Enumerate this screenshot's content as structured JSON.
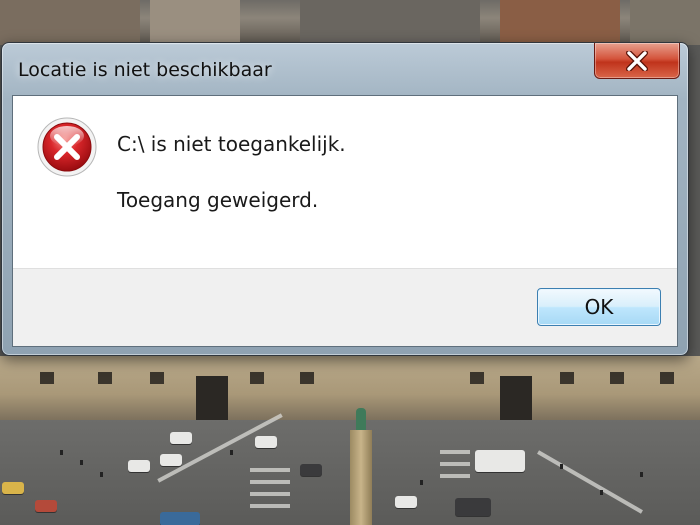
{
  "dialog": {
    "title": "Locatie is niet beschikbaar",
    "message": "C:\\ is niet toegankelijk.",
    "detail": "Toegang geweigerd.",
    "ok_label": "OK",
    "icon": "error-icon",
    "close_icon": "close-icon"
  },
  "colors": {
    "close_button": "#c7341c",
    "ok_button_border": "#3c7fb1",
    "error_red": "#c8171b",
    "footer_bg": "#f0f0f0"
  }
}
